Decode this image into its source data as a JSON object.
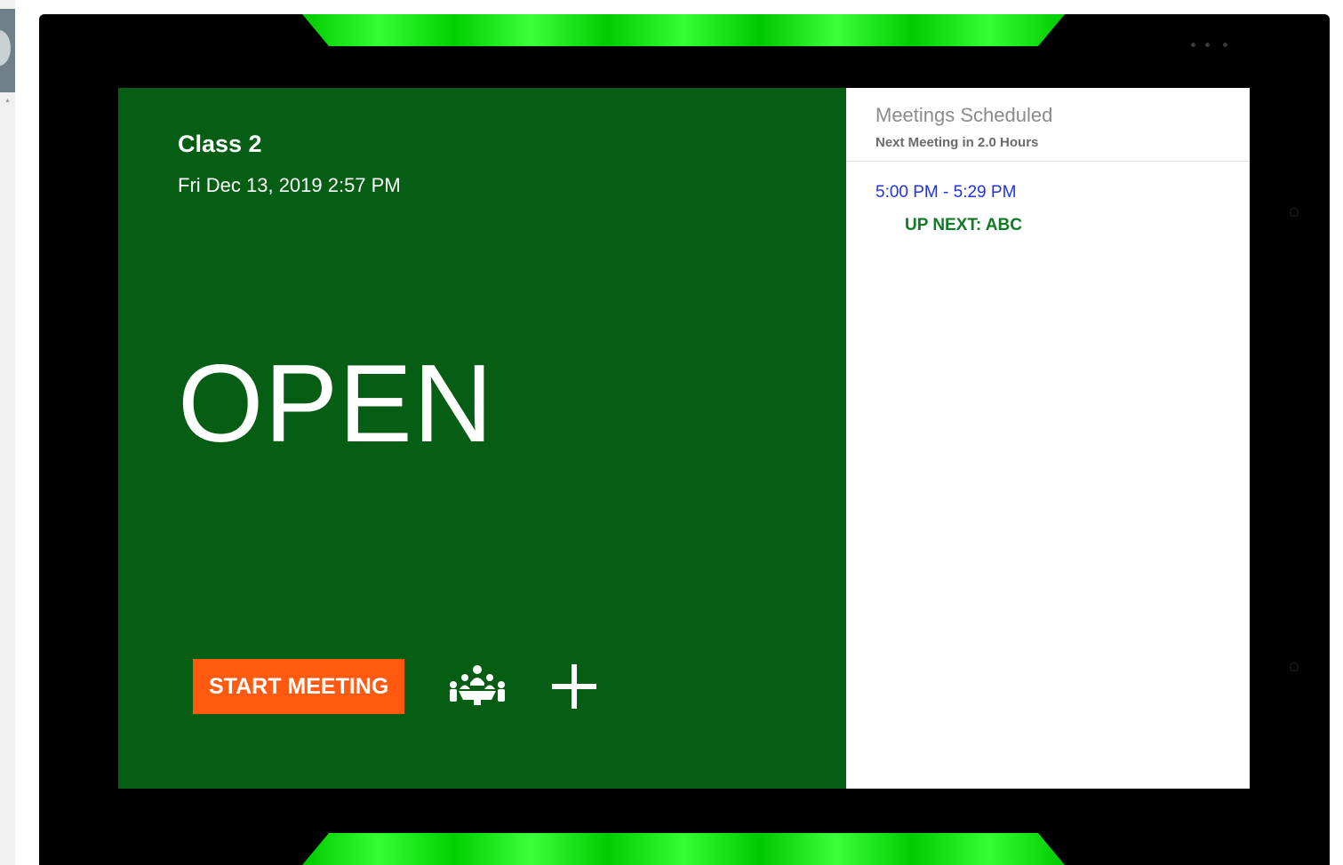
{
  "room": {
    "name": "Class 2",
    "datetime": "Fri Dec 13, 2019 2:57 PM",
    "status": "OPEN",
    "status_color": "#055e13"
  },
  "actions": {
    "start_meeting_label": "START MEETING",
    "start_meeting_color": "#ff5a10",
    "meeting_icon": "conference-people-icon",
    "add_icon": "plus-icon"
  },
  "schedule": {
    "title": "Meetings Scheduled",
    "subtitle": "Next Meeting in 2.0 Hours",
    "meetings": [
      {
        "time": "5:00 PM - 5:29 PM",
        "title": "UP NEXT: ABC"
      }
    ]
  },
  "device": {
    "led_color": "#22ee22"
  }
}
